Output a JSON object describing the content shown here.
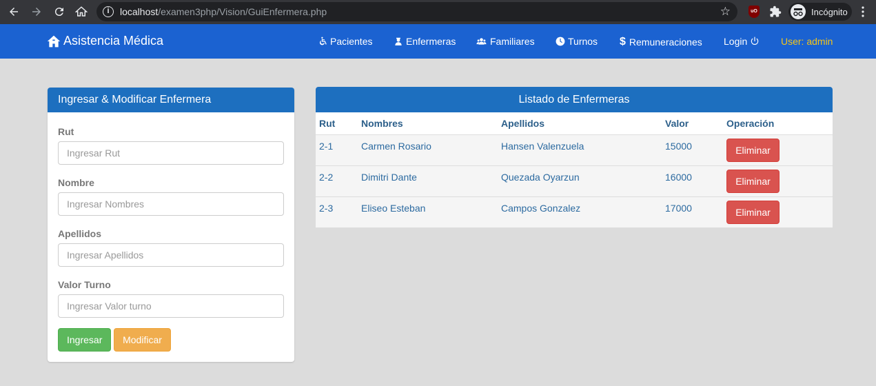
{
  "browser": {
    "url_host": "localhost",
    "url_path": "/examen3php/Vision/GuiEnfermera.php",
    "incognito_label": "Incógnito",
    "extension_label": "uO"
  },
  "navbar": {
    "brand": "Asistencia Médica",
    "items": [
      {
        "label": "Pacientes",
        "icon": "wheelchair-icon"
      },
      {
        "label": "Enfermeras",
        "icon": "nurse-icon"
      },
      {
        "label": "Familiares",
        "icon": "users-icon"
      },
      {
        "label": "Turnos",
        "icon": "clock-icon"
      },
      {
        "label": "Remuneraciones",
        "icon": "dollar-icon"
      },
      {
        "label": "Login",
        "icon": "power-icon"
      }
    ],
    "user": "User: admin"
  },
  "form": {
    "title": "Ingresar & Modificar Enfermera",
    "fields": [
      {
        "label": "Rut",
        "placeholder": "Ingresar Rut"
      },
      {
        "label": "Nombre",
        "placeholder": "Ingresar Nombres"
      },
      {
        "label": "Apellidos",
        "placeholder": "Ingresar Apellidos"
      },
      {
        "label": "Valor Turno",
        "placeholder": "Ingresar Valor turno"
      }
    ],
    "submit_label": "Ingresar",
    "modify_label": "Modificar"
  },
  "listing": {
    "title": "Listado de Enfermeras",
    "columns": [
      "Rut",
      "Nombres",
      "Apellidos",
      "Valor",
      "Operación"
    ],
    "rows": [
      {
        "rut": "2-1",
        "nombres": "Carmen Rosario",
        "apellidos": "Hansen Valenzuela",
        "valor": "15000"
      },
      {
        "rut": "2-2",
        "nombres": "Dimitri Dante",
        "apellidos": "Quezada Oyarzun",
        "valor": "16000"
      },
      {
        "rut": "2-3",
        "nombres": "Eliseo Esteban",
        "apellidos": "Campos Gonzalez",
        "valor": "17000"
      }
    ],
    "delete_label": "Eliminar"
  },
  "colors": {
    "navbar": "#1b62d1",
    "panel_header": "#1d6fbf",
    "success": "#5cb85c",
    "warning": "#f0ad4e",
    "danger": "#d9534f",
    "user_text": "#f5c518"
  }
}
